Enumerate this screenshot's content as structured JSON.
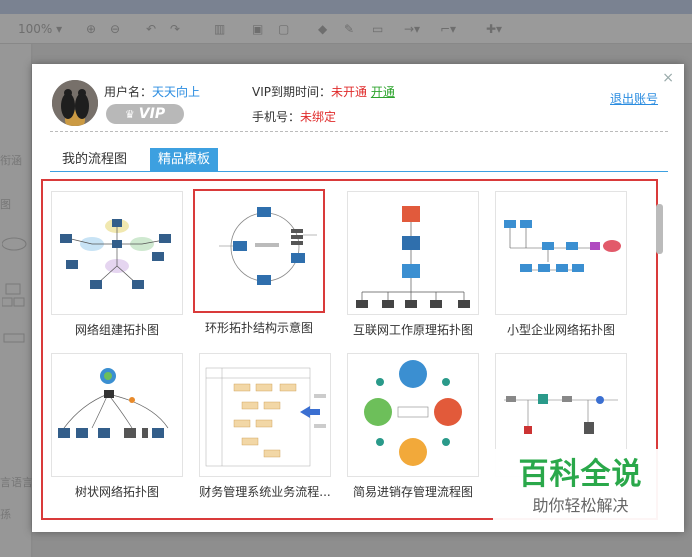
{
  "toolbar": {
    "zoom": "100%"
  },
  "sidebar": {
    "labels": [
      "衔涵",
      "图",
      "言语言",
      "孫"
    ]
  },
  "dialog": {
    "user_label": "用户名：",
    "user_name": "天天向上",
    "vip_badge": "VIP",
    "vip_expire_label": "VIP到期时间：",
    "vip_expire_value": "未开通",
    "open_link": "开通",
    "phone_label": "手机号：",
    "phone_value": "未绑定",
    "logout": "退出账号",
    "close": "×",
    "tabs": [
      {
        "label": "我的流程图",
        "active": false
      },
      {
        "label": "精品模板",
        "active": true
      }
    ],
    "templates": [
      {
        "label": "网络组建拓扑图"
      },
      {
        "label": "环形拓扑结构示意图",
        "selected": true
      },
      {
        "label": "互联网工作原理拓扑图"
      },
      {
        "label": "小型企业网络拓扑图"
      },
      {
        "label": "树状网络拓扑图"
      },
      {
        "label": "财务管理系统业务流程..."
      },
      {
        "label": "简易进销存管理流程图"
      },
      {
        "label": ""
      }
    ]
  },
  "watermark": {
    "title": "百科全说",
    "subtitle": "助你轻松解决"
  }
}
